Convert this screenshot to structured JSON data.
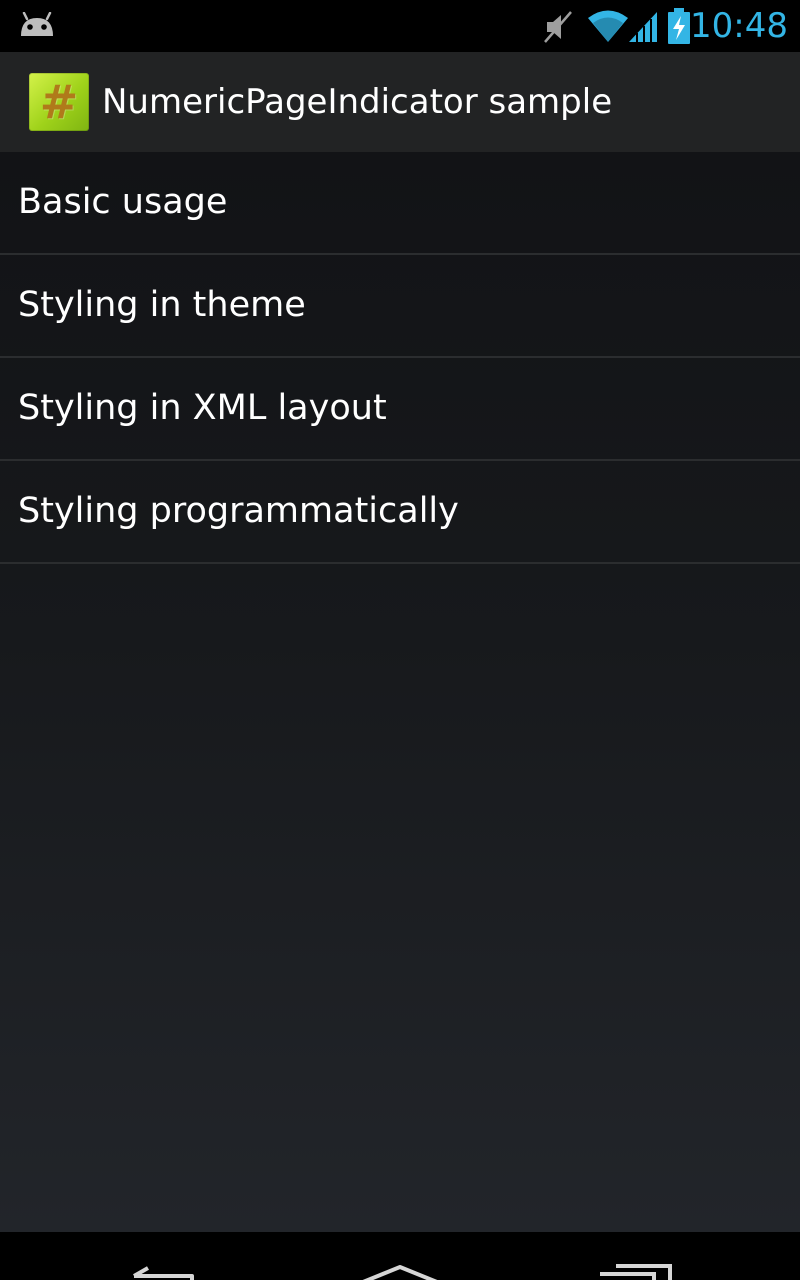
{
  "status_bar": {
    "time": "10:48",
    "icons": [
      "android-icon",
      "mute-icon",
      "wifi-icon",
      "signal-icon",
      "battery-charging-icon"
    ],
    "accent_color": "#33b5e5"
  },
  "action_bar": {
    "app_icon_glyph": "#",
    "title": "NumericPageIndicator sample"
  },
  "list": {
    "items": [
      {
        "label": "Basic usage"
      },
      {
        "label": "Styling in theme"
      },
      {
        "label": "Styling in XML layout"
      },
      {
        "label": "Styling programmatically"
      }
    ]
  },
  "nav_bar": {
    "icons": [
      "back-icon",
      "home-icon",
      "recents-icon"
    ]
  }
}
